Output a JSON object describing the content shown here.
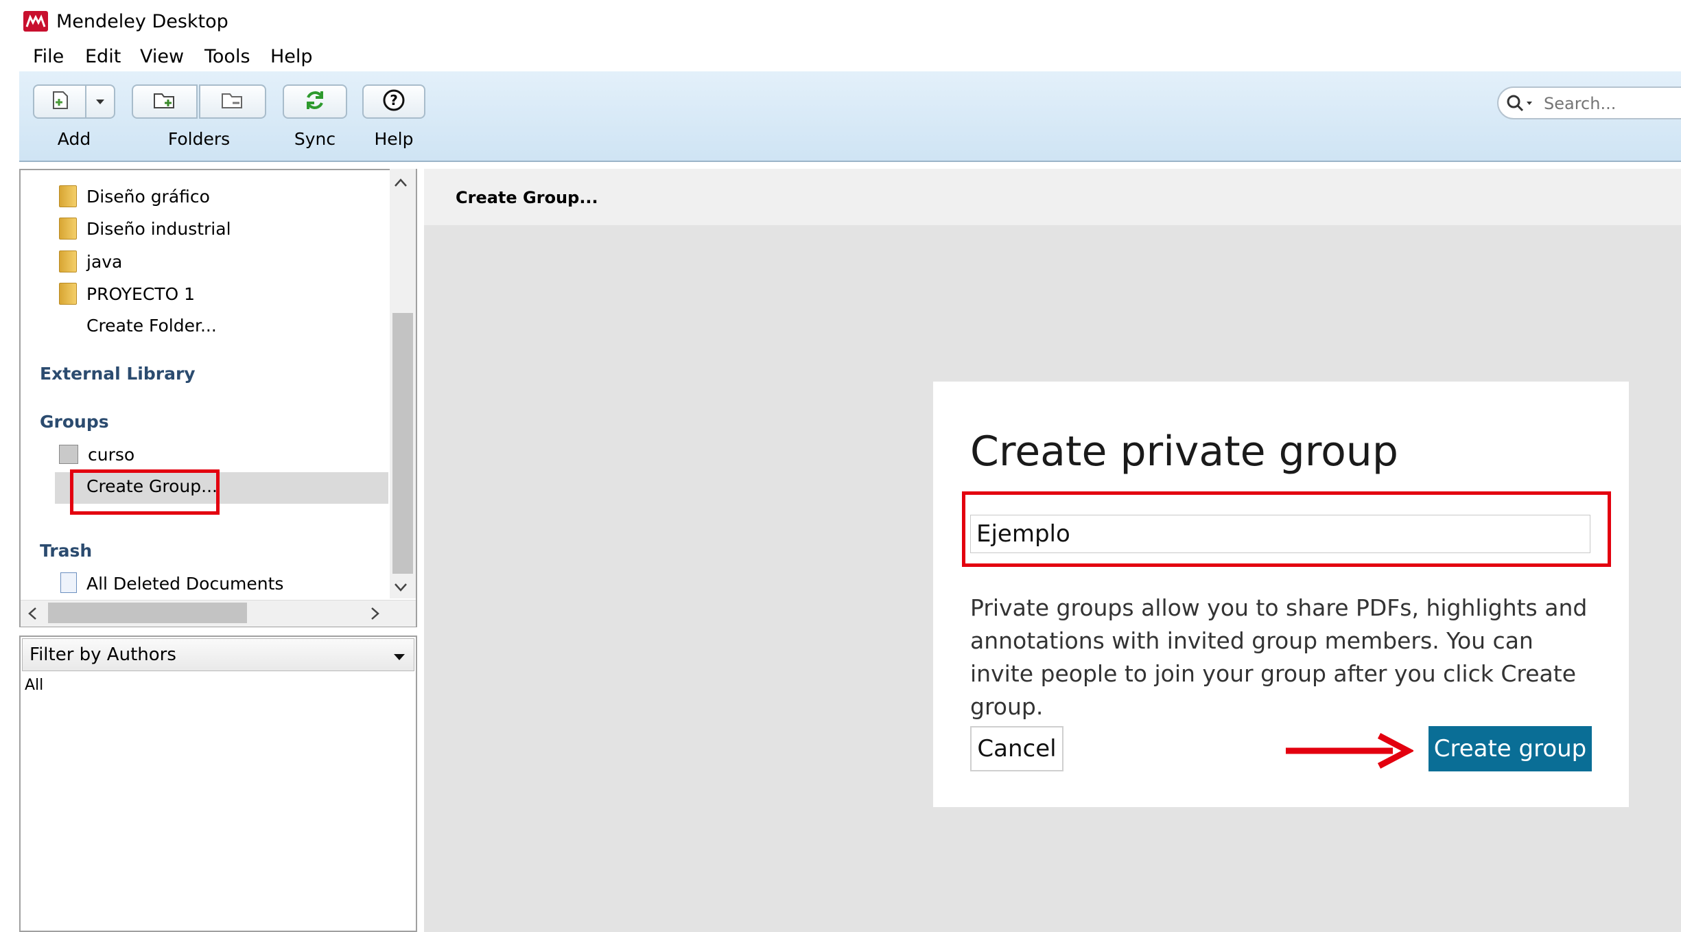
{
  "app": {
    "title": "Mendeley Desktop"
  },
  "menu": {
    "file": "File",
    "edit": "Edit",
    "view": "View",
    "tools": "Tools",
    "help": "Help"
  },
  "toolbar": {
    "add": "Add",
    "folders": "Folders",
    "sync": "Sync",
    "help": "Help",
    "search_placeholder": "Search..."
  },
  "sidebar": {
    "folders": [
      "Diseño gráfico",
      "Diseño industrial",
      "java",
      "PROYECTO 1"
    ],
    "create_folder": "Create Folder...",
    "external_library": "External Library",
    "groups_heading": "Groups",
    "group_curso": "curso",
    "create_group": "Create Group...",
    "trash_heading": "Trash",
    "all_deleted": "All Deleted Documents"
  },
  "filter": {
    "label": "Filter by Authors",
    "value": "All"
  },
  "content": {
    "header": "Create Group..."
  },
  "dialog": {
    "title": "Create private group",
    "input_value": "Ejemplo",
    "description": "Private groups allow you to share PDFs, highlights and annotations with invited group members. You can invite people to join your group after you click Create group.",
    "cancel": "Cancel",
    "create": "Create group"
  },
  "colors": {
    "accent": "#0a6e96",
    "annotation": "#e3000f",
    "sidebar_heading": "#2b4b6f"
  },
  "icons": [
    "mendeley-logo-icon",
    "add-document-icon",
    "dropdown-arrow-icon",
    "add-folder-icon",
    "remove-folder-icon",
    "sync-icon",
    "help-icon",
    "search-icon",
    "folder-icon",
    "group-icon",
    "trash-document-icon",
    "arrow-right-icon"
  ]
}
